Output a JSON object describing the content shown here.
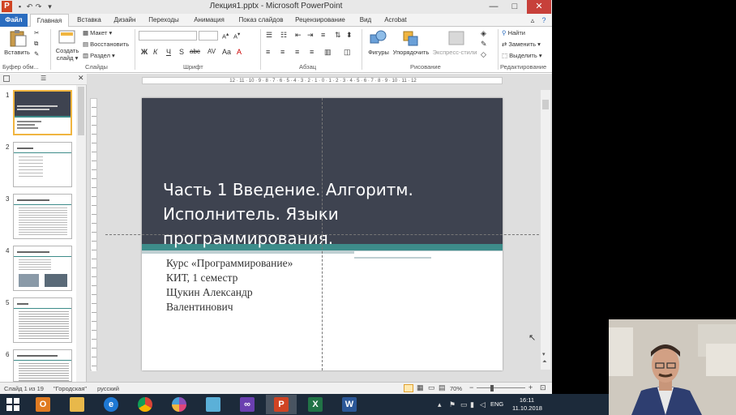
{
  "window": {
    "title": "Лекция1.pptx - Microsoft PowerPoint",
    "app_letter": "P",
    "controls": {
      "minimize": "—",
      "maximize": "□",
      "close": "✕"
    }
  },
  "tabs": [
    {
      "label": "Файл"
    },
    {
      "label": "Главная"
    },
    {
      "label": "Вставка"
    },
    {
      "label": "Дизайн"
    },
    {
      "label": "Переходы"
    },
    {
      "label": "Анимация"
    },
    {
      "label": "Показ слайдов"
    },
    {
      "label": "Рецензирование"
    },
    {
      "label": "Вид"
    },
    {
      "label": "Acrobat"
    }
  ],
  "ribbon": {
    "paste": "Вставить",
    "create_slide_1": "Создать",
    "create_slide_2": "слайд ▾",
    "layout": "Макет ▾",
    "reset": "Восстановить",
    "section": "Раздел ▾",
    "shapes": "Фигуры",
    "arrange": "Упорядочить",
    "quick_styles": "Экспресс-стили",
    "find": "Найти",
    "replace": "Заменить ▾",
    "select": "Выделить ▾",
    "groups": {
      "clipboard": "Буфер обм...",
      "slides": "Слайды",
      "font": "Шрифт",
      "paragraph": "Абзац",
      "drawing": "Рисование",
      "editing": "Редактирование"
    },
    "format_buttons": {
      "bold": "Ж",
      "italic": "К",
      "underline": "Ч",
      "strike": "S",
      "shadow": "abc"
    }
  },
  "ruler": {
    "labels": "12 · 11 · 10 · 9 · 8 · 7 · 6 · 5 · 4 · 3 · 2 · 1 · 0 · 1 · 2 · 3 · 4 · 5 · 6 · 7 · 8 · 9 · 10 · 11 · 12"
  },
  "thumbnails": [
    {
      "num": "1",
      "active": true
    },
    {
      "num": "2",
      "active": false
    },
    {
      "num": "3",
      "active": false
    },
    {
      "num": "4",
      "active": false
    },
    {
      "num": "5",
      "active": false
    },
    {
      "num": "6",
      "active": false
    }
  ],
  "slide": {
    "title_line1": "Часть 1 Введение. Алгоритм.",
    "title_line2": "Исполнитель. Языки",
    "title_line3": "программирования.",
    "sub_line1": "Курс «Программирование»",
    "sub_line2": "КИТ, 1 семестр",
    "sub_line3": "Щукин Александр",
    "sub_line4": "Валентинович",
    "colors": {
      "dark": "#3e4350",
      "teal": "#3d8c8a"
    }
  },
  "status": {
    "slide_info": "Слайд 1 из 19",
    "theme": "\"Городская\"",
    "language": "русский",
    "zoom": "70%",
    "zoom_minus": "−",
    "zoom_plus": "+"
  },
  "taskbar": {
    "lang": "ENG",
    "time": "16:11",
    "date": "11.10.2018",
    "apps": [
      {
        "name": "outlook",
        "letter": "O",
        "color": "#e07b21"
      },
      {
        "name": "explorer",
        "letter": "",
        "color": "#e8b84a"
      },
      {
        "name": "ie",
        "letter": "e",
        "color": "#1e78d2"
      },
      {
        "name": "chrome",
        "letter": "",
        "color": "#db4437"
      },
      {
        "name": "app5",
        "letter": "",
        "color": "#8b4fb8"
      },
      {
        "name": "app6",
        "letter": "",
        "color": "#5bb0d8"
      },
      {
        "name": "visual-studio",
        "letter": "",
        "color": "#6a3fb0"
      },
      {
        "name": "powerpoint",
        "letter": "P",
        "color": "#d04423"
      },
      {
        "name": "excel",
        "letter": "X",
        "color": "#217346"
      },
      {
        "name": "word",
        "letter": "W",
        "color": "#2b5797"
      }
    ]
  }
}
